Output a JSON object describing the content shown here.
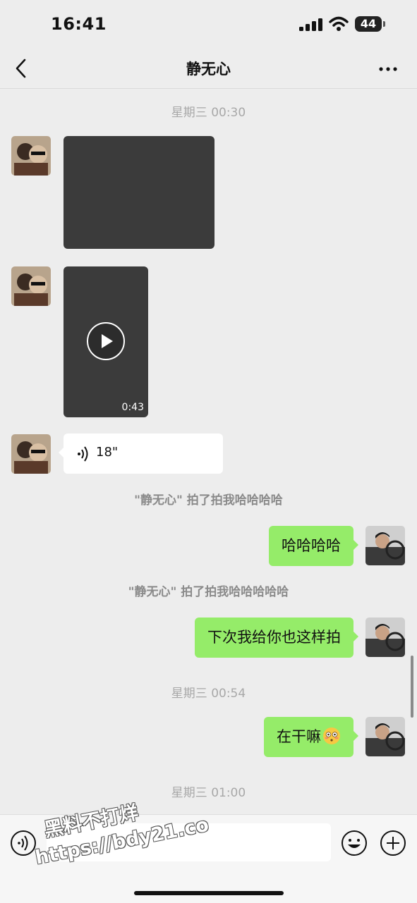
{
  "status_bar": {
    "time": "16:41",
    "battery": "44"
  },
  "nav": {
    "title": "静无心",
    "back_icon": "chevron-left-icon",
    "more_icon": "ellipsis-icon"
  },
  "messages": {
    "timestamp_1": "星期三 00:30",
    "video_duration": "0:43",
    "voice_duration": "18\"",
    "system_note_1": "\"静无心\" 拍了拍我哈哈哈哈",
    "out_text_1": "哈哈哈哈",
    "system_note_2": "\"静无心\" 拍了拍我哈哈哈哈哈",
    "out_text_2": "下次我给你也这样拍",
    "timestamp_2": "星期三 00:54",
    "out_text_3": "在干嘛",
    "out_text_3_emoji": "flushed-face-emoji",
    "timestamp_3": "星期三 01:00"
  },
  "input_bar": {
    "placeholder": "",
    "watermark_line_1": "黑料不打烊",
    "watermark_line_2": "https://bdy21.co"
  },
  "colors": {
    "outgoing_bubble": "#95ec69",
    "incoming_bubble": "#ffffff",
    "background": "#ededed"
  }
}
